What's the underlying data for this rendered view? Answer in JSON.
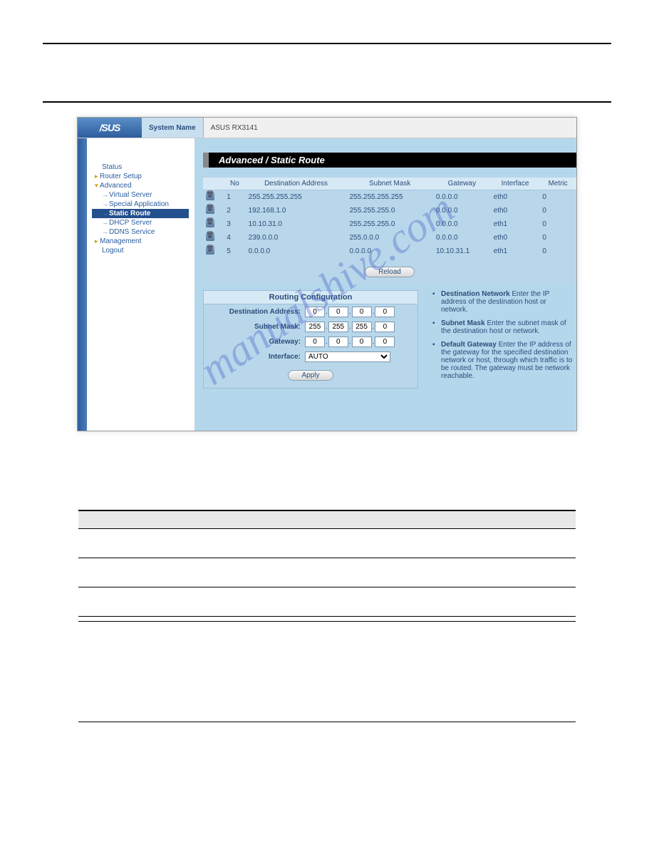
{
  "topbar": {
    "logo": "/SUS",
    "sysname_label": "System Name",
    "sysname_value": "ASUS RX3141"
  },
  "sidebar": {
    "items": [
      {
        "label": "Status",
        "type": "plain"
      },
      {
        "label": "Router Setup",
        "type": "top"
      },
      {
        "label": "Advanced",
        "type": "open"
      },
      {
        "label": "Virtual Server",
        "type": "sub"
      },
      {
        "label": "Special Application",
        "type": "sub"
      },
      {
        "label": "Static Route",
        "type": "sub",
        "active": true
      },
      {
        "label": "DHCP Server",
        "type": "sub"
      },
      {
        "label": "DDNS Service",
        "type": "sub"
      },
      {
        "label": "Management",
        "type": "top"
      },
      {
        "label": "Logout",
        "type": "plain"
      }
    ]
  },
  "page_title": "Advanced / Static Route",
  "route_table": {
    "headers": [
      "",
      "No",
      "Destination Address",
      "Subnet Mask",
      "Gateway",
      "Interface",
      "Metric"
    ],
    "rows": [
      {
        "no": "1",
        "dest": "255.255.255.255",
        "mask": "255.255.255.255",
        "gw": "0.0.0.0",
        "iface": "eth0",
        "metric": "0"
      },
      {
        "no": "2",
        "dest": "192.168.1.0",
        "mask": "255.255.255.0",
        "gw": "0.0.0.0",
        "iface": "eth0",
        "metric": "0"
      },
      {
        "no": "3",
        "dest": "10.10.31.0",
        "mask": "255.255.255.0",
        "gw": "0.0.0.0",
        "iface": "eth1",
        "metric": "0"
      },
      {
        "no": "4",
        "dest": "239.0.0.0",
        "mask": "255.0.0.0",
        "gw": "0.0.0.0",
        "iface": "eth0",
        "metric": "0"
      },
      {
        "no": "5",
        "dest": "0.0.0.0",
        "mask": "0.0.0.0",
        "gw": "10.10.31.1",
        "iface": "eth1",
        "metric": "0"
      }
    ]
  },
  "buttons": {
    "reload": "Reload",
    "apply": "Apply"
  },
  "config": {
    "title": "Routing Configuration",
    "dest_label": "Destination Address:",
    "mask_label": "Subnet Mask:",
    "gw_label": "Gateway:",
    "iface_label": "Interface:",
    "dest": [
      "0",
      "0",
      "0",
      "0"
    ],
    "mask": [
      "255",
      "255",
      "255",
      "0"
    ],
    "gw": [
      "0",
      "0",
      "0",
      "0"
    ],
    "iface_value": "AUTO"
  },
  "help": {
    "items": [
      {
        "term": "Destination Network",
        "text": " Enter the IP address of the destination host or network."
      },
      {
        "term": "Subnet Mask",
        "text": " Enter the subnet mask of the destination host or network."
      },
      {
        "term": "Default Gateway",
        "text": " Enter the IP address of the gateway for the specified destination network or host, through which traffic is to be routed. The gateway must be network reachable."
      }
    ]
  },
  "watermark": "manualshive.com"
}
